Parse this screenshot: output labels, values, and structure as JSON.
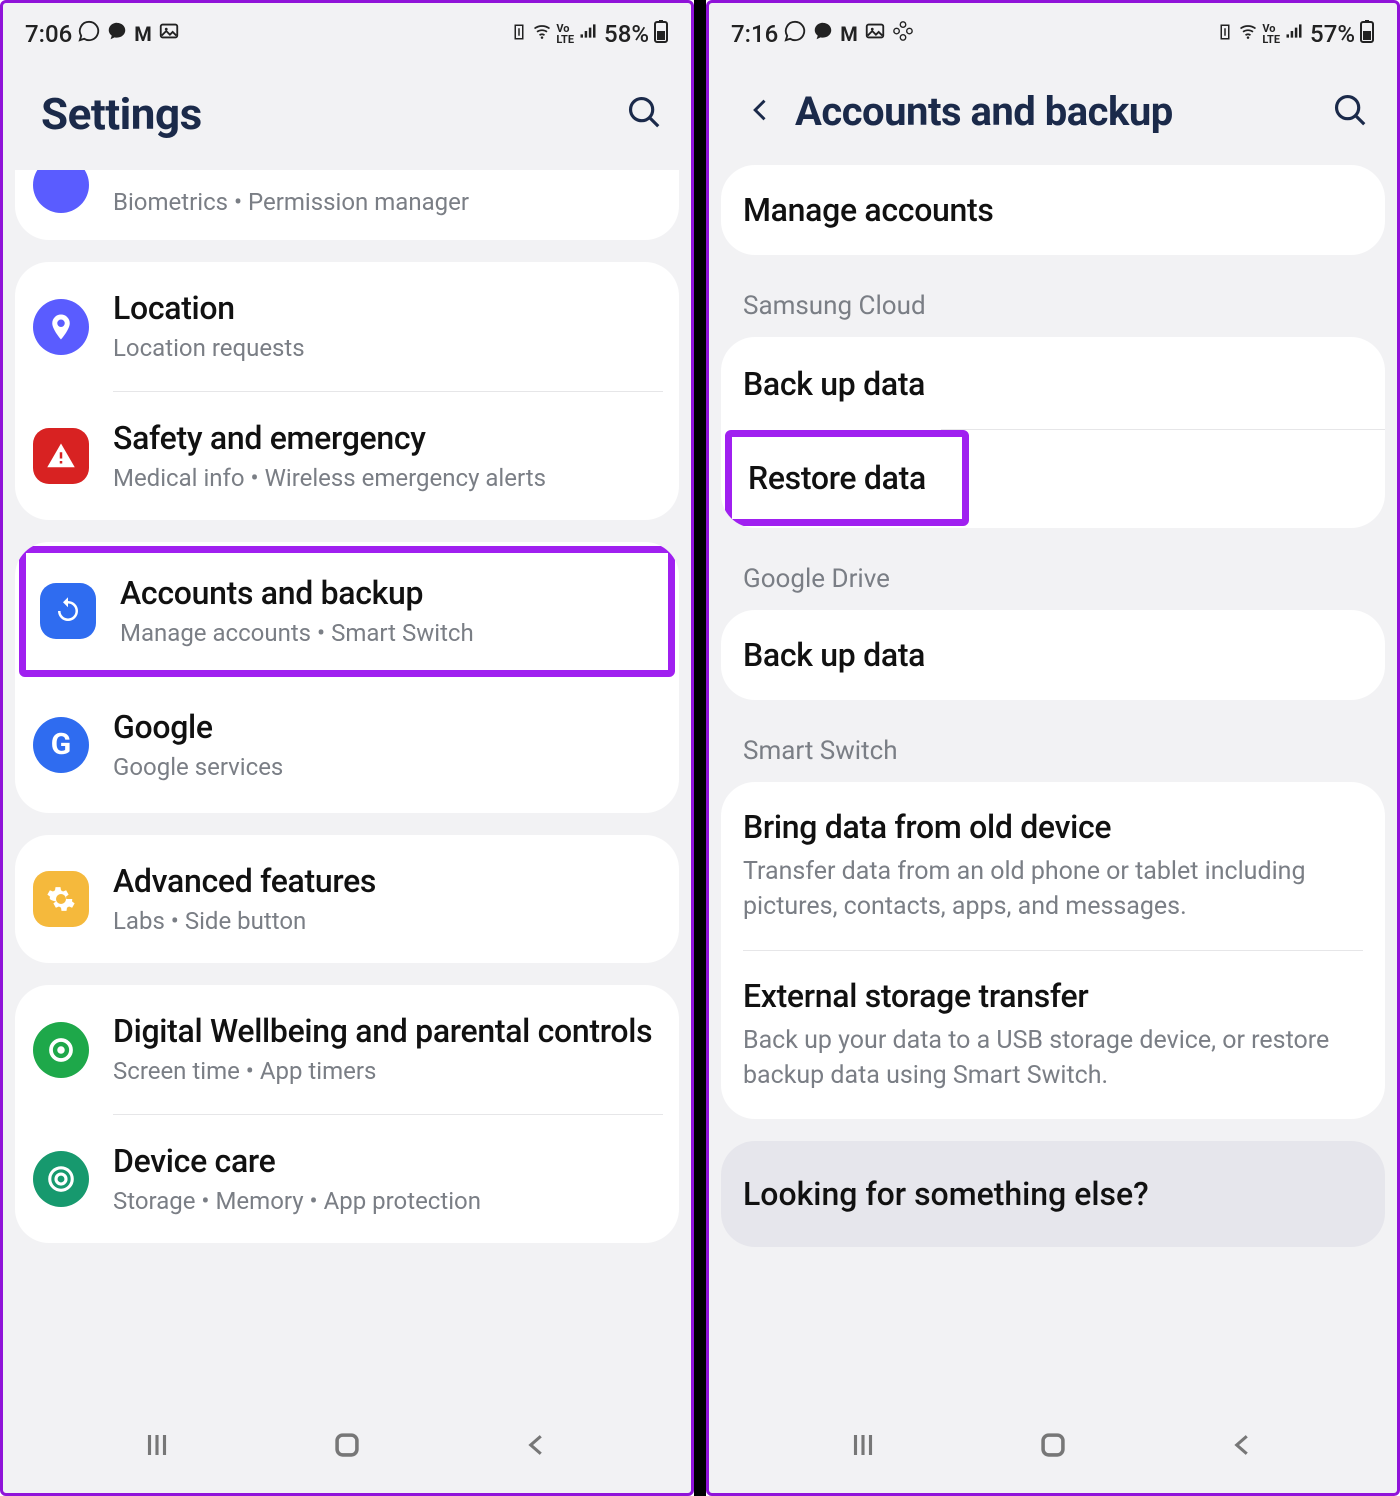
{
  "left": {
    "status": {
      "time": "7:06",
      "battery": "58%"
    },
    "header": {
      "title": "Settings"
    },
    "topcut": {
      "subtitle": "Biometrics  •  Permission manager"
    },
    "card1": [
      {
        "title": "Location",
        "subtitle": "Location requests",
        "icon": "location",
        "bg": "ic-blue1"
      },
      {
        "title": "Safety and emergency",
        "subtitle": "Medical info  •  Wireless emergency alerts",
        "icon": "alert",
        "bg": "ic-red"
      }
    ],
    "card2": [
      {
        "title": "Accounts and backup",
        "subtitle": "Manage accounts  •  Smart Switch",
        "icon": "sync",
        "bg": "ic-blue2",
        "hl": true
      },
      {
        "title": "Google",
        "subtitle": "Google services",
        "icon": "google",
        "bg": "ic-bluedark"
      }
    ],
    "card3": [
      {
        "title": "Advanced features",
        "subtitle": "Labs  •  Side button",
        "icon": "gear",
        "bg": "ic-orange"
      }
    ],
    "card4": [
      {
        "title": "Digital Wellbeing and parental controls",
        "subtitle": "Screen time  •  App timers",
        "icon": "wellbeing",
        "bg": "ic-green"
      },
      {
        "title": "Device care",
        "subtitle": "Storage  •  Memory  •  App protection",
        "icon": "device",
        "bg": "ic-teal"
      }
    ]
  },
  "right": {
    "status": {
      "time": "7:16",
      "battery": "57%"
    },
    "header": {
      "title": "Accounts and backup"
    },
    "manage": {
      "title": "Manage accounts"
    },
    "group1": {
      "label": "Samsung Cloud",
      "items": [
        {
          "title": "Back up data"
        },
        {
          "title": "Restore data",
          "hl": true
        }
      ]
    },
    "group2": {
      "label": "Google Drive",
      "items": [
        {
          "title": "Back up data"
        }
      ]
    },
    "group3": {
      "label": "Smart Switch",
      "items": [
        {
          "title": "Bring data from old device",
          "subtitle": "Transfer data from an old phone or tablet including pictures, contacts, apps, and messages."
        },
        {
          "title": "External storage transfer",
          "subtitle": "Back up your data to a USB storage device, or restore backup data using Smart Switch."
        }
      ]
    },
    "looking": "Looking for something else?"
  }
}
